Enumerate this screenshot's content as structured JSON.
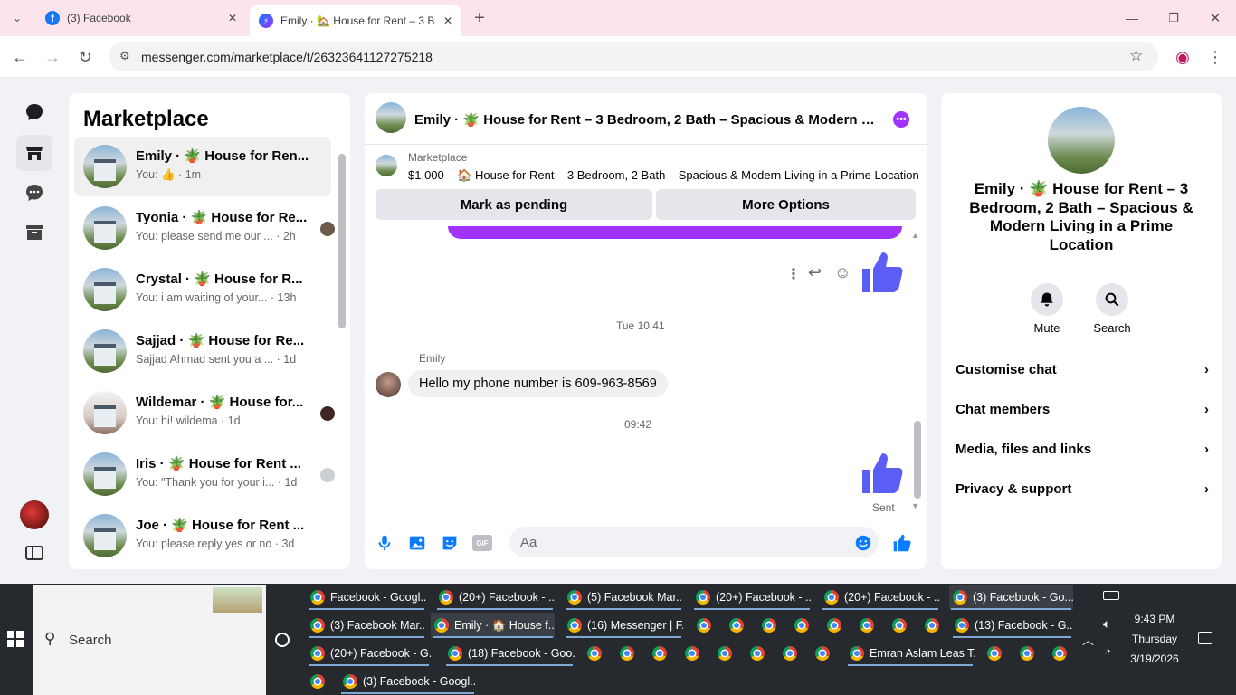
{
  "browser": {
    "tabs": [
      {
        "title": "(3) Facebook",
        "active": false
      },
      {
        "title": "Emily · 🏡 House for Rent – 3 B",
        "active": true
      }
    ],
    "url": "messenger.com/marketplace/t/26323641127275218"
  },
  "list": {
    "title": "Marketplace",
    "conversations": [
      {
        "name": "Emily · 🪴 House for Ren...",
        "preview": "You: 👍 · 1m",
        "selected": true
      },
      {
        "name": "Tyonia · 🪴 House for Re...",
        "preview": "You: please send me our ... · 2h"
      },
      {
        "name": "Crystal · 🪴 House for R...",
        "preview": "You: i am waiting of your... · 13h"
      },
      {
        "name": "Sajjad · 🪴 House for Re...",
        "preview": "Sajjad Ahmad sent you a ... · 1d"
      },
      {
        "name": "Wildemar · 🪴 House for...",
        "preview": "You: hi! wildema · 1d"
      },
      {
        "name": "Iris · 🪴 House for Rent ...",
        "preview": "You: \"Thank you for your i... · 1d"
      },
      {
        "name": "Joe · 🪴 House for Rent ...",
        "preview": "You: please reply yes or no · 3d"
      }
    ]
  },
  "chat": {
    "title": "Emily · 🪴 House for Rent – 3 Bedroom, 2 Bath – Spacious & Modern Livi...",
    "marketplace_label": "Marketplace",
    "listing": "$1,000 – 🏠 House for Rent – 3 Bedroom, 2 Bath – Spacious & Modern Living in a Prime Location",
    "mark_pending": "Mark as pending",
    "more_options": "More Options",
    "timestamp1": "Tue 10:41",
    "sender": "Emily",
    "message": "Hello my phone number is 609-963-8569",
    "timestamp2": "09:42",
    "sent": "Sent",
    "composer_placeholder": "Aa"
  },
  "details": {
    "title": "Emily · 🪴 House for Rent – 3 Bedroom, 2 Bath – Spacious & Modern Living in a Prime Location",
    "mute": "Mute",
    "search": "Search",
    "rows": [
      "Customise chat",
      "Chat members",
      "Media, files and links",
      "Privacy & support"
    ]
  },
  "taskbar": {
    "search": "Search",
    "items": [
      "Facebook - Googl...",
      "(20+) Facebook - ...",
      "(5) Facebook Mar...",
      "(20+) Facebook - ...",
      "(20+) Facebook - ...",
      "(3) Facebook - Go...",
      "(3) Facebook Mar...",
      "Emily · 🏠 House f...",
      "(16) Messenger | F...",
      "(13) Facebook - G...",
      "(20+) Facebook - G...",
      "(18) Facebook - Goo...",
      "Emran Aslam Leas T...",
      "(3) Facebook - Googl..."
    ],
    "time": "9:43 PM",
    "day": "Thursday",
    "date": "3/19/2026"
  }
}
